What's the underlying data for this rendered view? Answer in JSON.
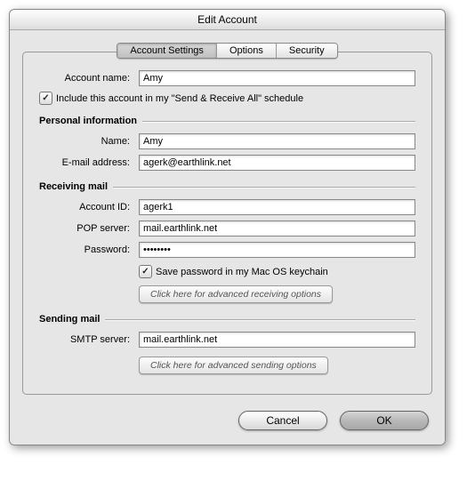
{
  "window": {
    "title": "Edit Account"
  },
  "tabs": {
    "accountSettings": "Account Settings",
    "options": "Options",
    "security": "Security"
  },
  "accountName": {
    "label": "Account name:",
    "value": "Amy"
  },
  "includeSchedule": {
    "checked": true,
    "label": "Include this account in my \"Send & Receive All\" schedule"
  },
  "sections": {
    "personal": "Personal information",
    "receiving": "Receiving mail",
    "sending": "Sending mail"
  },
  "personal": {
    "nameLabel": "Name:",
    "nameValue": "Amy",
    "emailLabel": "E-mail address:",
    "emailValue": "agerk@earthlink.net"
  },
  "receiving": {
    "accountIdLabel": "Account ID:",
    "accountIdValue": "agerk1",
    "popLabel": "POP server:",
    "popValue": "mail.earthlink.net",
    "passwordLabel": "Password:",
    "passwordValue": "••••••••",
    "saveKeychain": {
      "checked": true,
      "label": "Save password in my Mac OS keychain"
    },
    "advanced": "Click here for advanced receiving options"
  },
  "sending": {
    "smtpLabel": "SMTP server:",
    "smtpValue": "mail.earthlink.net",
    "advanced": "Click here for advanced sending options"
  },
  "buttons": {
    "cancel": "Cancel",
    "ok": "OK"
  }
}
